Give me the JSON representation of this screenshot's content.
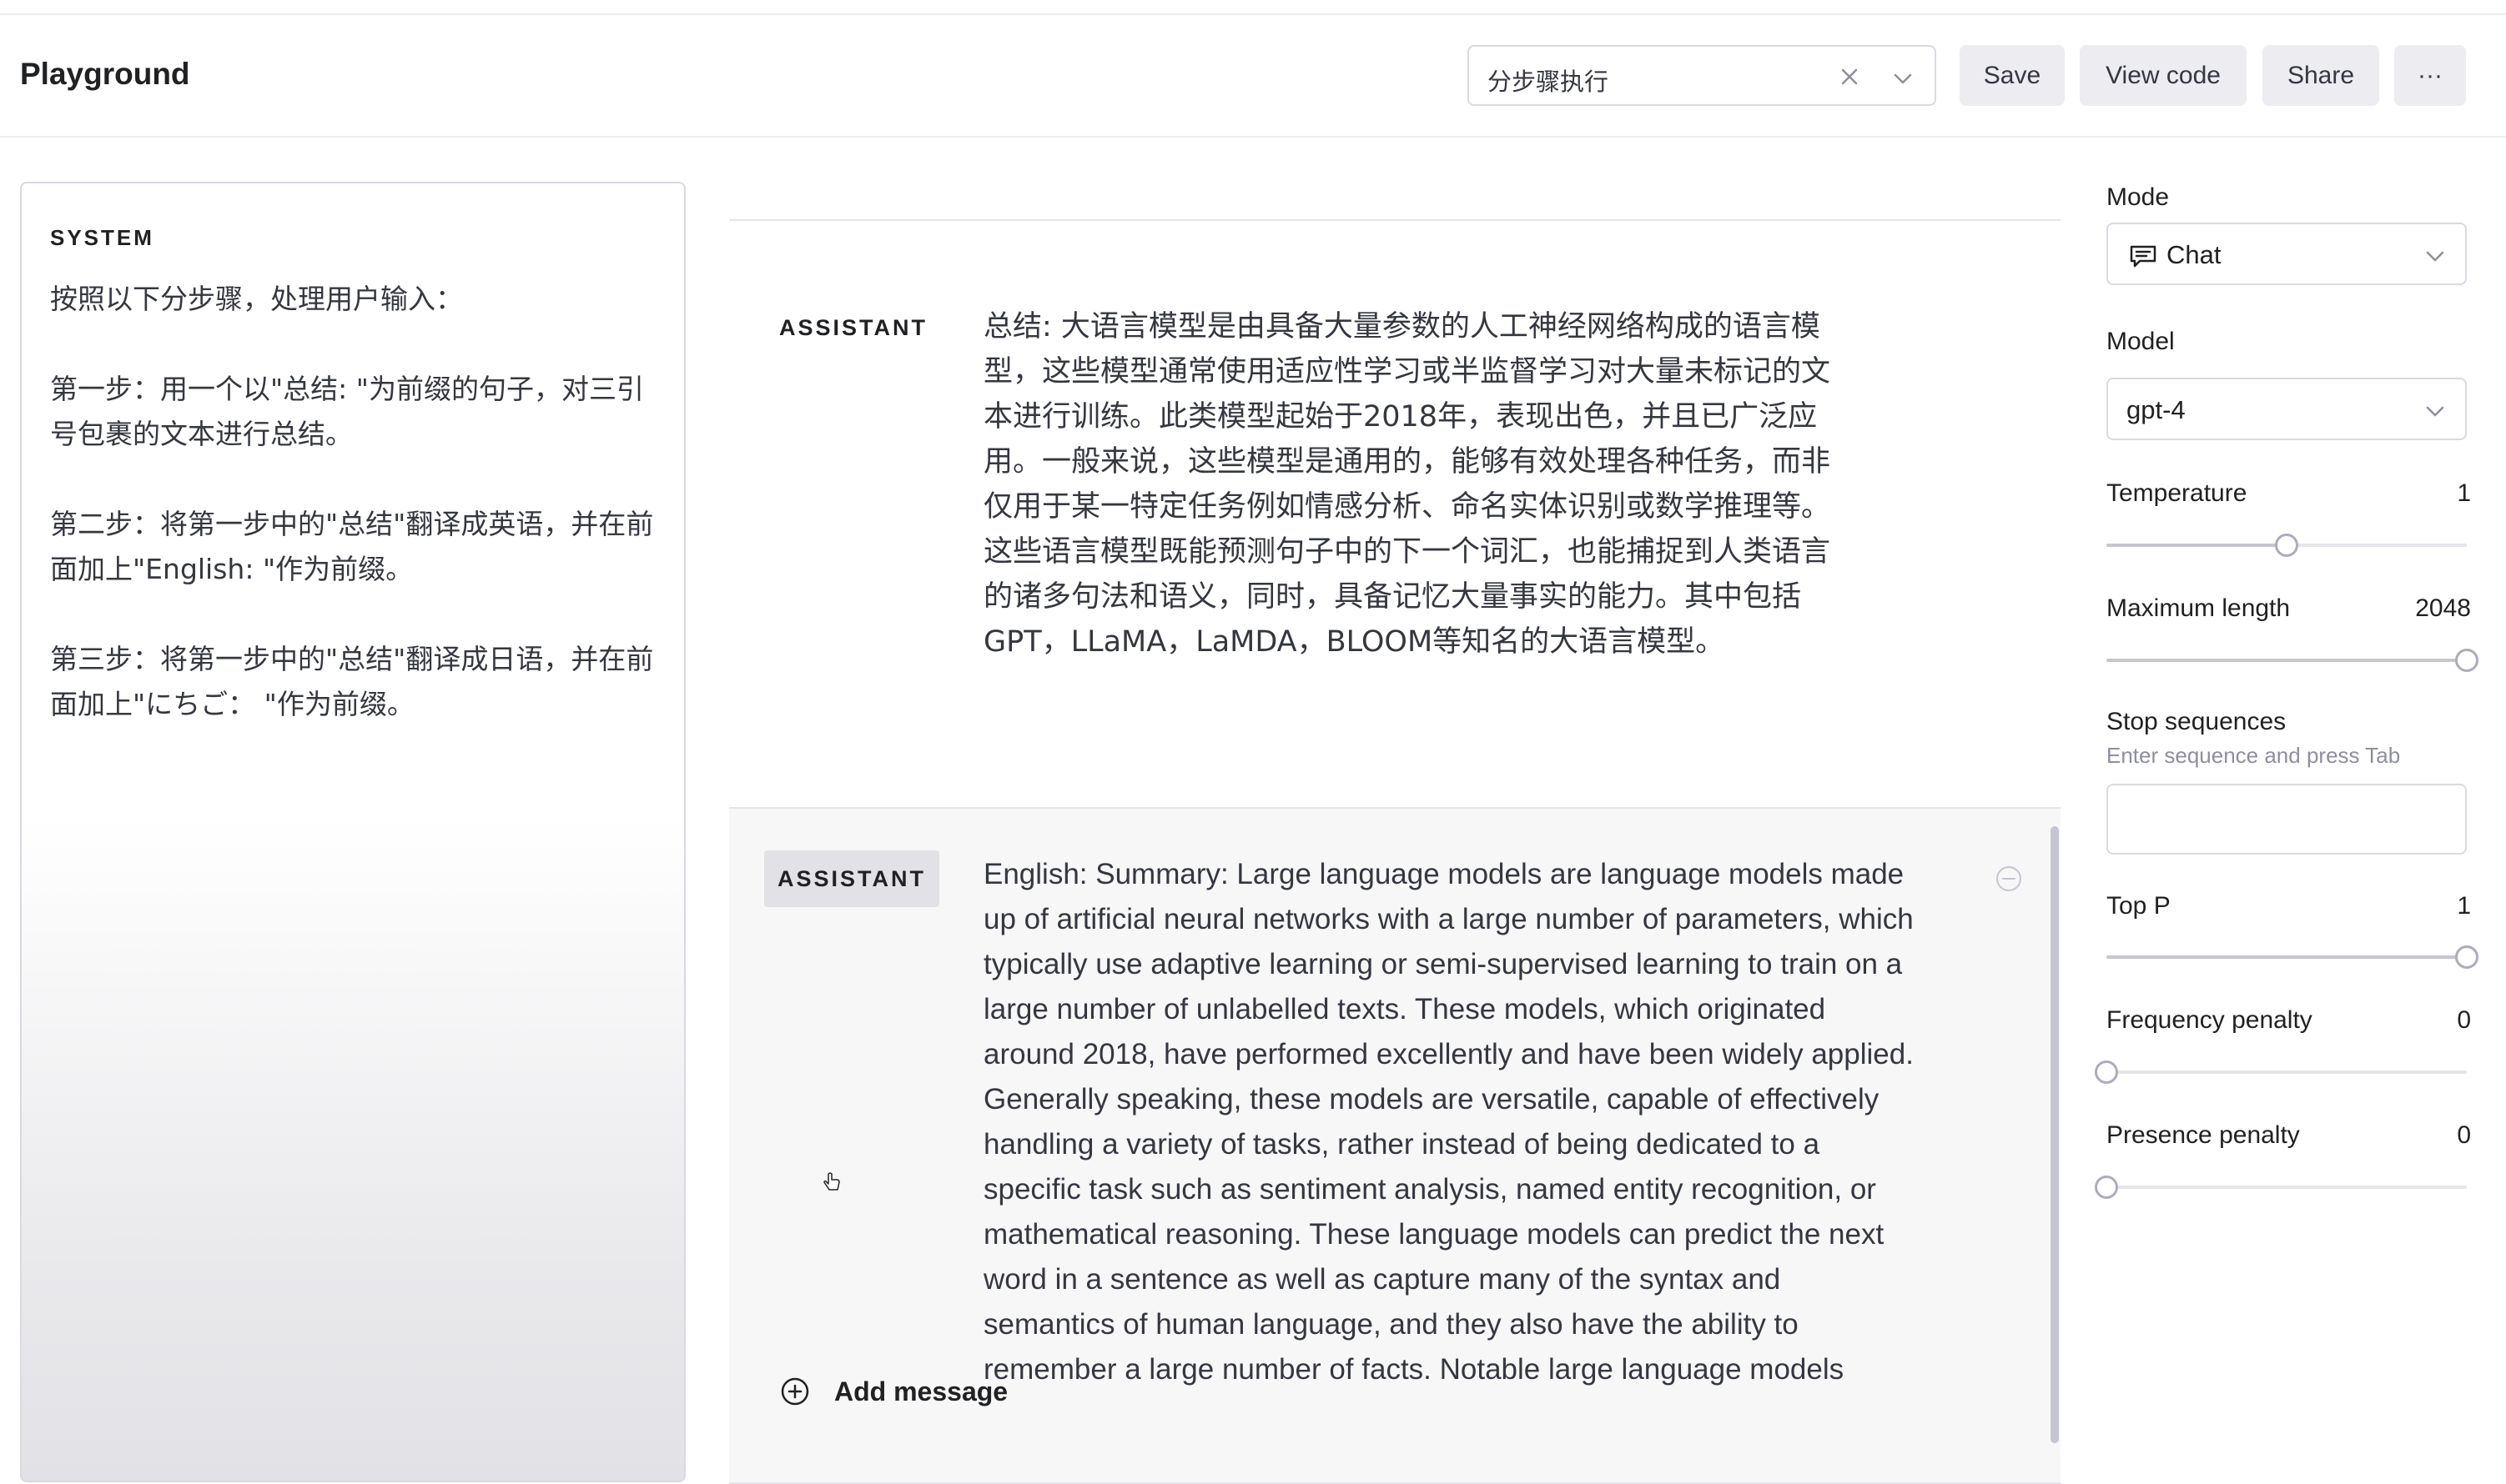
{
  "header": {
    "title": "Playground",
    "preset_value": "分步骤执行",
    "save_label": "Save",
    "view_code_label": "View code",
    "share_label": "Share",
    "more_label": "···"
  },
  "system": {
    "label": "SYSTEM",
    "text": "按照以下分步骤，处理用户输入：\n\n第一步：用一个以\"总结: \"为前缀的句子，对三引号包裹的文本进行总结。\n\n第二步：将第一步中的\"总结\"翻译成英语，并在前面加上\"English: \"作为前缀。\n\n第三步：将第一步中的\"总结\"翻译成日语，并在前面加上\"にちご： \"作为前缀。"
  },
  "messages": [
    {
      "role": "ASSISTANT",
      "text": "总结: 大语言模型是由具备大量参数的人工神经网络构成的语言模型，这些模型通常使用适应性学习或半监督学习对大量未标记的文本进行训练。此类模型起始于2018年，表现出色，并且已广泛应用。一般来说，这些模型是通用的，能够有效处理各种任务，而非仅用于某一特定任务例如情感分析、命名实体识别或数学推理等。这些语言模型既能预测句子中的下一个词汇，也能捕捉到人类语言的诸多句法和语义，同时，具备记忆大量事实的能力。其中包括GPT，LLaMA，LaMDA，BLOOM等知名的大语言模型。"
    },
    {
      "role": "ASSISTANT",
      "text": "English: Summary: Large language models are language models made up of artificial neural networks with a large number of parameters, which typically use adaptive learning or semi-supervised learning to train on a large number of unlabelled texts. These models, which originated around 2018, have performed excellently and have been widely applied. Generally speaking, these models are versatile, capable of effectively handling a variety of tasks, rather instead of being dedicated to a specific task such as sentiment analysis, named entity recognition, or mathematical reasoning. These language models can predict the next word in a sentence as well as capture many of the syntax and semantics of human language, and they also have the ability to remember a large number of facts. Notable large language models"
    }
  ],
  "add_message_label": "Add message",
  "settings": {
    "mode_label": "Mode",
    "mode_value": "Chat",
    "model_label": "Model",
    "model_value": "gpt-4",
    "temperature_label": "Temperature",
    "temperature_value": "1",
    "temperature_fraction": 0.5,
    "max_length_label": "Maximum length",
    "max_length_value": "2048",
    "max_length_fraction": 1.0,
    "stop_label": "Stop sequences",
    "stop_hint": "Enter sequence and press Tab",
    "top_p_label": "Top P",
    "top_p_value": "1",
    "top_p_fraction": 1.0,
    "frequency_label": "Frequency penalty",
    "frequency_value": "0",
    "frequency_fraction": 0.0,
    "presence_label": "Presence penalty",
    "presence_value": "0",
    "presence_fraction": 0.0
  },
  "colors": {
    "accent_bg": "#ececf1",
    "border": "#d9d9e3",
    "text": "#202123"
  }
}
